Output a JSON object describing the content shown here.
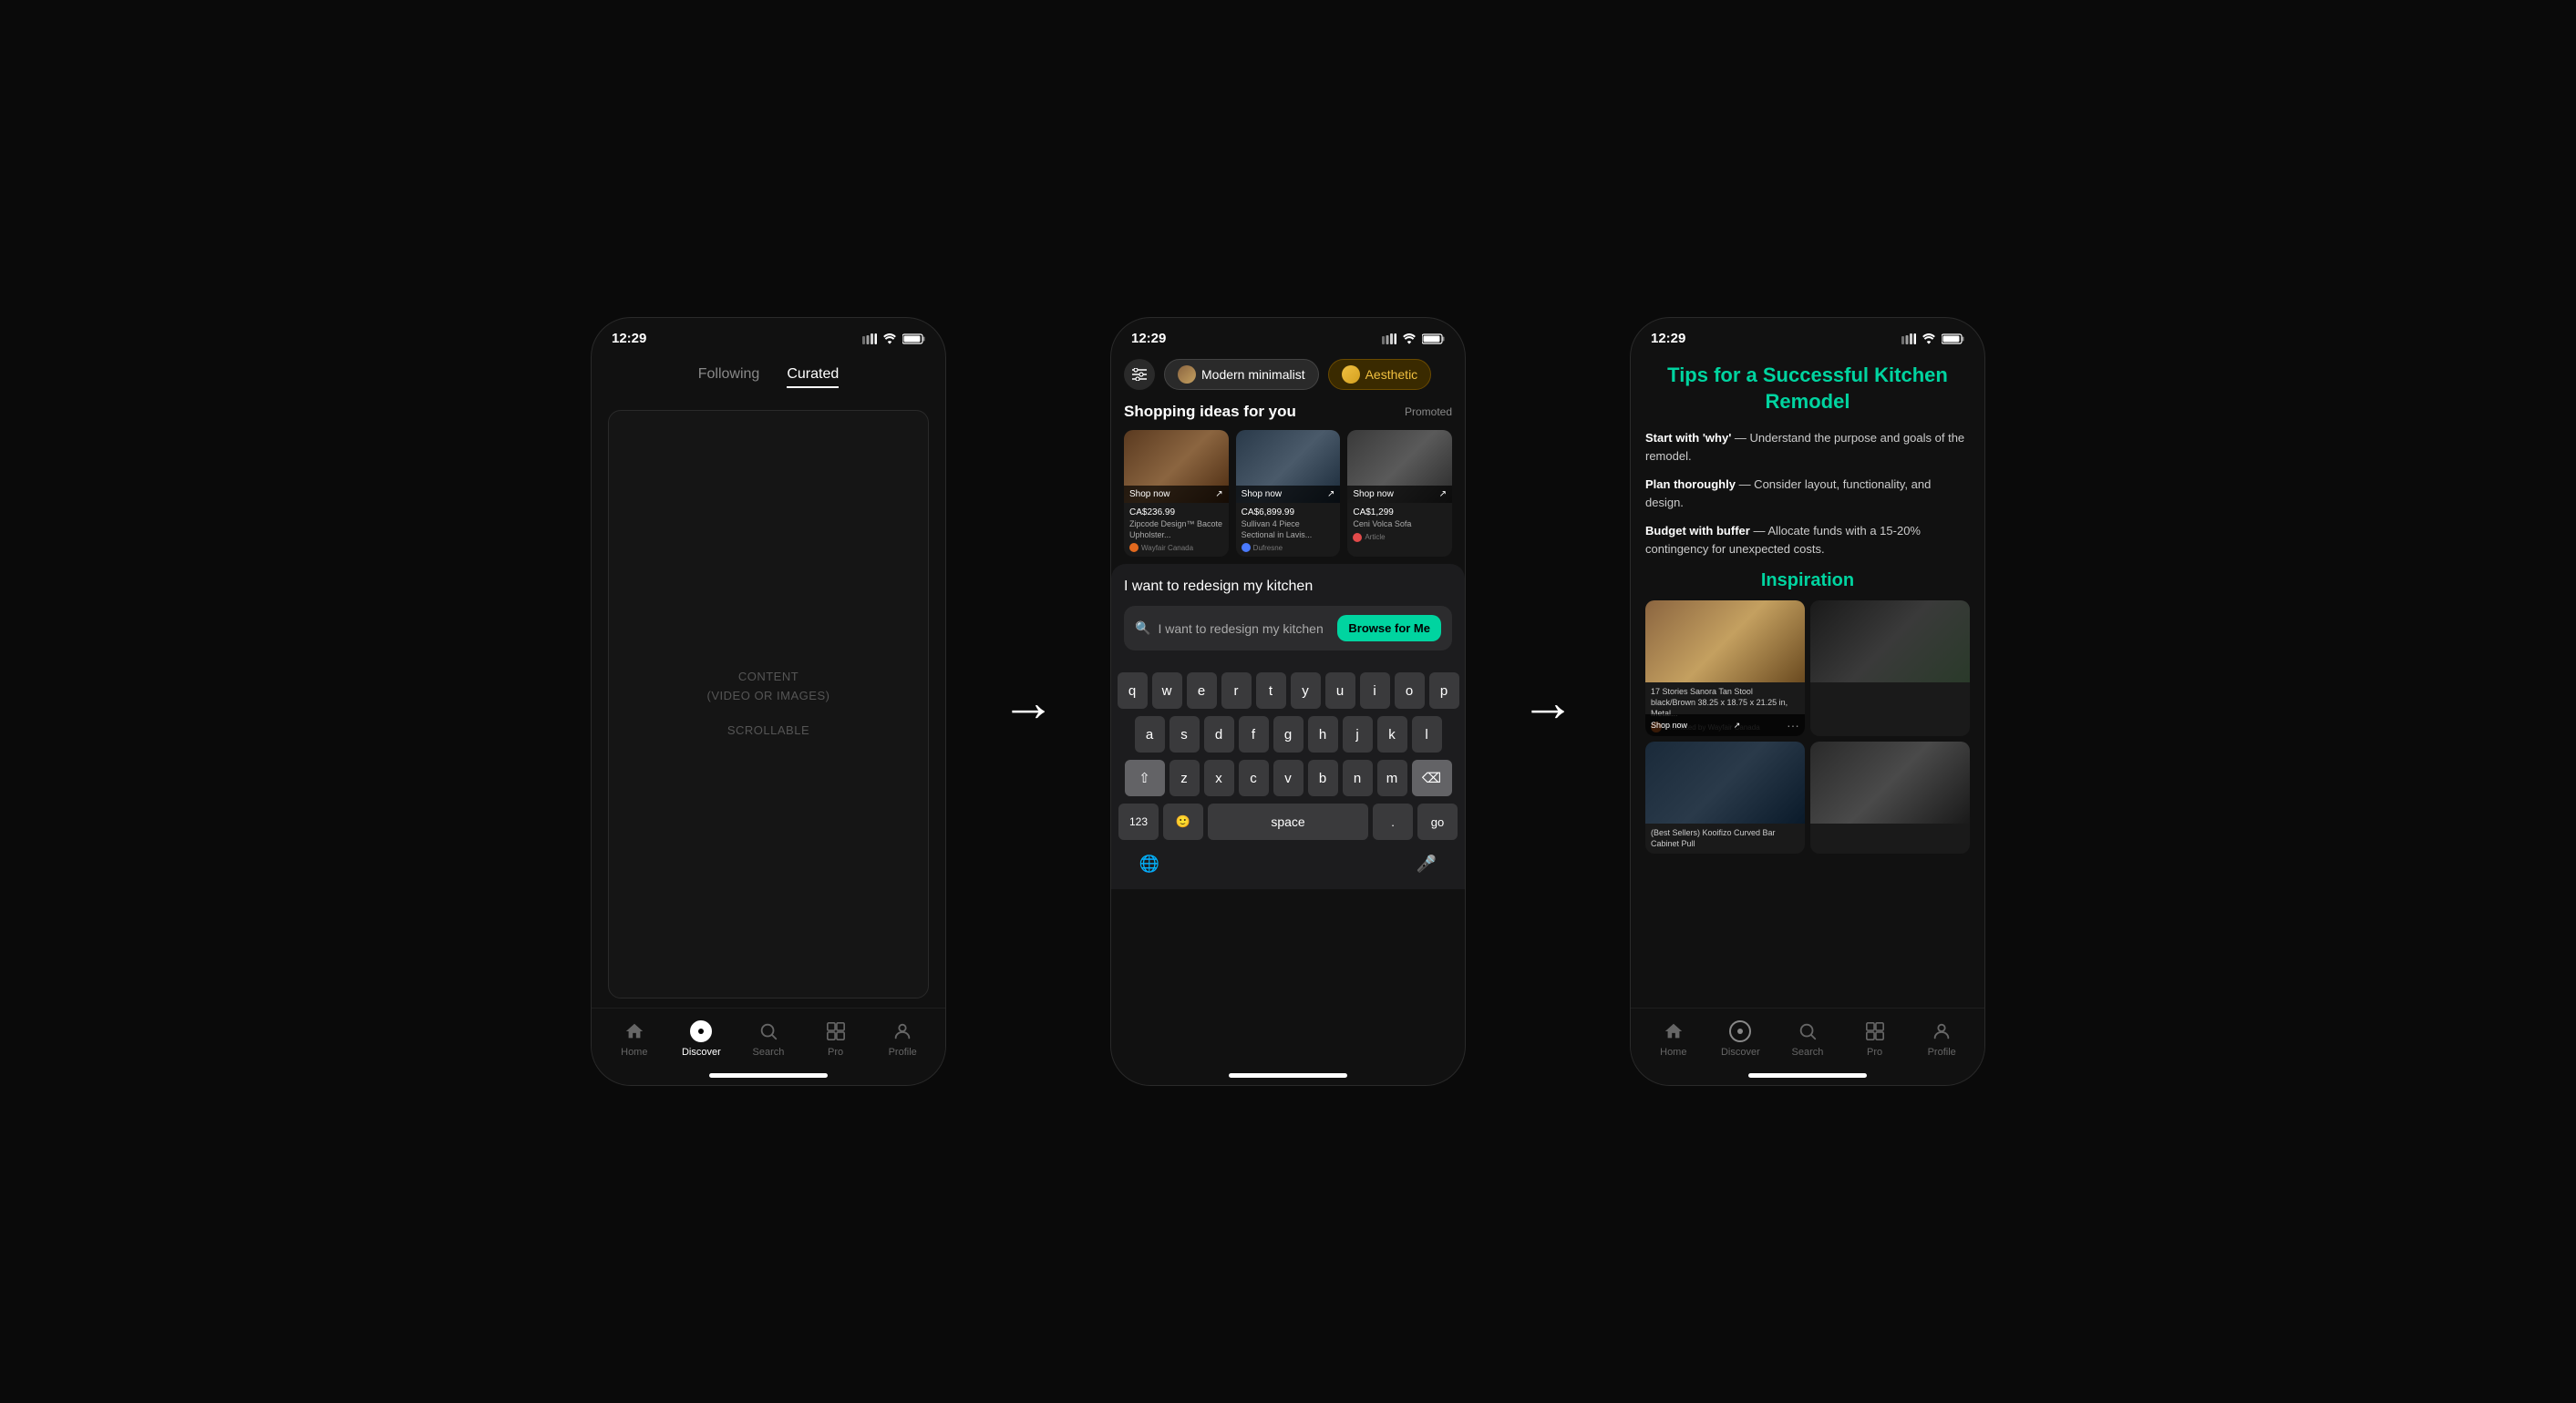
{
  "screen1": {
    "time": "12:29",
    "tabs": [
      "Following",
      "Curated"
    ],
    "active_tab": "Curated",
    "content": {
      "line1": "CONTENT",
      "line2": "(VIDEO OR IMAGES)",
      "line3": "SCROLLABLE"
    },
    "nav": {
      "items": [
        "Home",
        "Discover",
        "Search",
        "Pro",
        "Profile"
      ]
    }
  },
  "screen2": {
    "time": "12:29",
    "filter_pills": [
      {
        "label": "Modern minimalist",
        "type": "modern"
      },
      {
        "label": "Aesthetic",
        "type": "aesthetic"
      }
    ],
    "shopping": {
      "title": "Shopping ideas for you",
      "badge": "Promoted",
      "products": [
        {
          "price": "CA$236.99",
          "name": "Zipcode Design™ Bacote Upholster...",
          "source": "Wayfair Canada",
          "source_color": "orange"
        },
        {
          "price": "CA$6,899.99",
          "name": "Sullivan 4 Piece Sectional in Lavis...",
          "source": "Dufresne",
          "source_color": "blue"
        },
        {
          "price": "CA$1,299",
          "name": "Ceni Volca Sofa",
          "source": "Article",
          "source_color": "red"
        }
      ],
      "shop_now": "Shop now"
    },
    "search_overlay": {
      "query_text": "I want to redesign my kitchen",
      "input_placeholder": "I want to redesign my kitchen",
      "browse_btn": "Browse for Me"
    },
    "keyboard": {
      "row1": [
        "q",
        "w",
        "e",
        "r",
        "t",
        "y",
        "u",
        "i",
        "o",
        "p"
      ],
      "row2": [
        "a",
        "s",
        "d",
        "f",
        "g",
        "h",
        "j",
        "k",
        "l"
      ],
      "row3": [
        "z",
        "x",
        "c",
        "v",
        "b",
        "n",
        "m"
      ],
      "bottom": {
        "numbers": "123",
        "emoji": "🙂",
        "space": "space",
        "period": ".",
        "go": "go"
      }
    },
    "nav": {
      "items": [
        "Home",
        "Discover",
        "Search",
        "Pro",
        "Profile"
      ]
    }
  },
  "screen3": {
    "time": "12:29",
    "article": {
      "title": "Tips for a Successful Kitchen Remodel",
      "tips": [
        {
          "bold": "Start with 'why'",
          "text": " — Understand the purpose and goals of the remodel."
        },
        {
          "bold": "Plan thoroughly",
          "text": " — Consider layout, functionality, and design."
        },
        {
          "bold": "Budget with buffer",
          "text": " — Allocate funds with a 15-20% contingency for unexpected costs."
        }
      ],
      "inspiration_title": "Inspiration",
      "products": [
        {
          "name": "17 Stories Sanora Tan Stool black/Brown 38.25 x 18.75 x 21.25 in, Metal...",
          "source": "Promoted by Wayfair Canada",
          "has_shop": true
        },
        {
          "name": "(Best Sellers) Kooifizo Curved Bar Cabinet Pull",
          "source": "",
          "has_shop": false
        }
      ]
    },
    "nav": {
      "items": [
        "Home",
        "Discover",
        "Search",
        "Pro",
        "Profile"
      ]
    }
  },
  "arrows": [
    "→",
    "→"
  ],
  "icons": {
    "home": "🏠",
    "discover": "◉",
    "search": "🔍",
    "pro": "⊞",
    "profile": "👤",
    "filter": "⚙",
    "backspace": "⌫",
    "shift": "⇧",
    "globe": "🌐",
    "mic": "🎤"
  }
}
